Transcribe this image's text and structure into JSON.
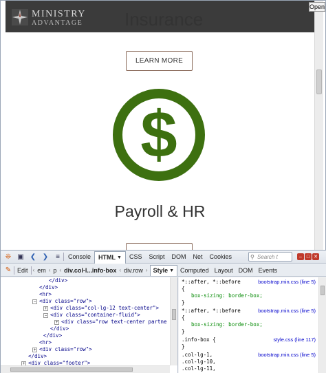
{
  "browser": {
    "open_button": "Open"
  },
  "site": {
    "logo_line1": "MINISTRY",
    "logo_line2": "ADVANTAGE",
    "heading": "Insurance",
    "learn_more": "LEARN MORE",
    "section_title": "Payroll & HR",
    "icon_color": "#3d7010"
  },
  "devtools": {
    "tabs": [
      "Console",
      "HTML",
      "CSS",
      "Script",
      "DOM",
      "Net",
      "Cookies"
    ],
    "active_tab": "HTML",
    "search_placeholder": "Search t",
    "edit_label": "Edit",
    "breadcrumbs": [
      "em",
      "p",
      "div.col-l...info-box",
      "div.row"
    ],
    "side_tabs": [
      "Style",
      "Computed",
      "Layout",
      "DOM",
      "Events"
    ],
    "html_lines": [
      {
        "text": "</div>"
      },
      {
        "text": "</div>"
      },
      {
        "text": "<hr>"
      },
      {
        "text": "<div class=\"row\">"
      },
      {
        "text": "<div class=\"col-lg-12 text-center\">"
      },
      {
        "text": "<div class=\"container-fluid\">"
      },
      {
        "text": "<div class=\"row text-center partne"
      },
      {
        "text": "</div>"
      },
      {
        "text": "</div>"
      },
      {
        "text": "<hr>"
      },
      {
        "text": "<div class=\"row\">"
      },
      {
        "text": "</div>"
      },
      {
        "text": "<div class=\"footer\">"
      }
    ],
    "style_rules": [
      {
        "selector": "*::after, *::before",
        "source": "bootstrap.min.css (line 5)",
        "brace": "{",
        "decl": "box-sizing: border-box;",
        "close": "}"
      },
      {
        "selector": "*::after, *::before",
        "source": "bootstrap.min.css (line 5)",
        "brace": "{",
        "decl": "box-sizing: border-box;",
        "close": "}"
      },
      {
        "selector": ".info-box {",
        "source": "style.css (line 117)",
        "close": "}"
      },
      {
        "selector": ".col-lg-1,",
        "source": "bootstrap.min.css (line 5)",
        "more1": ".col-lg-10,",
        "more2": ".col-lg-11,"
      }
    ]
  }
}
